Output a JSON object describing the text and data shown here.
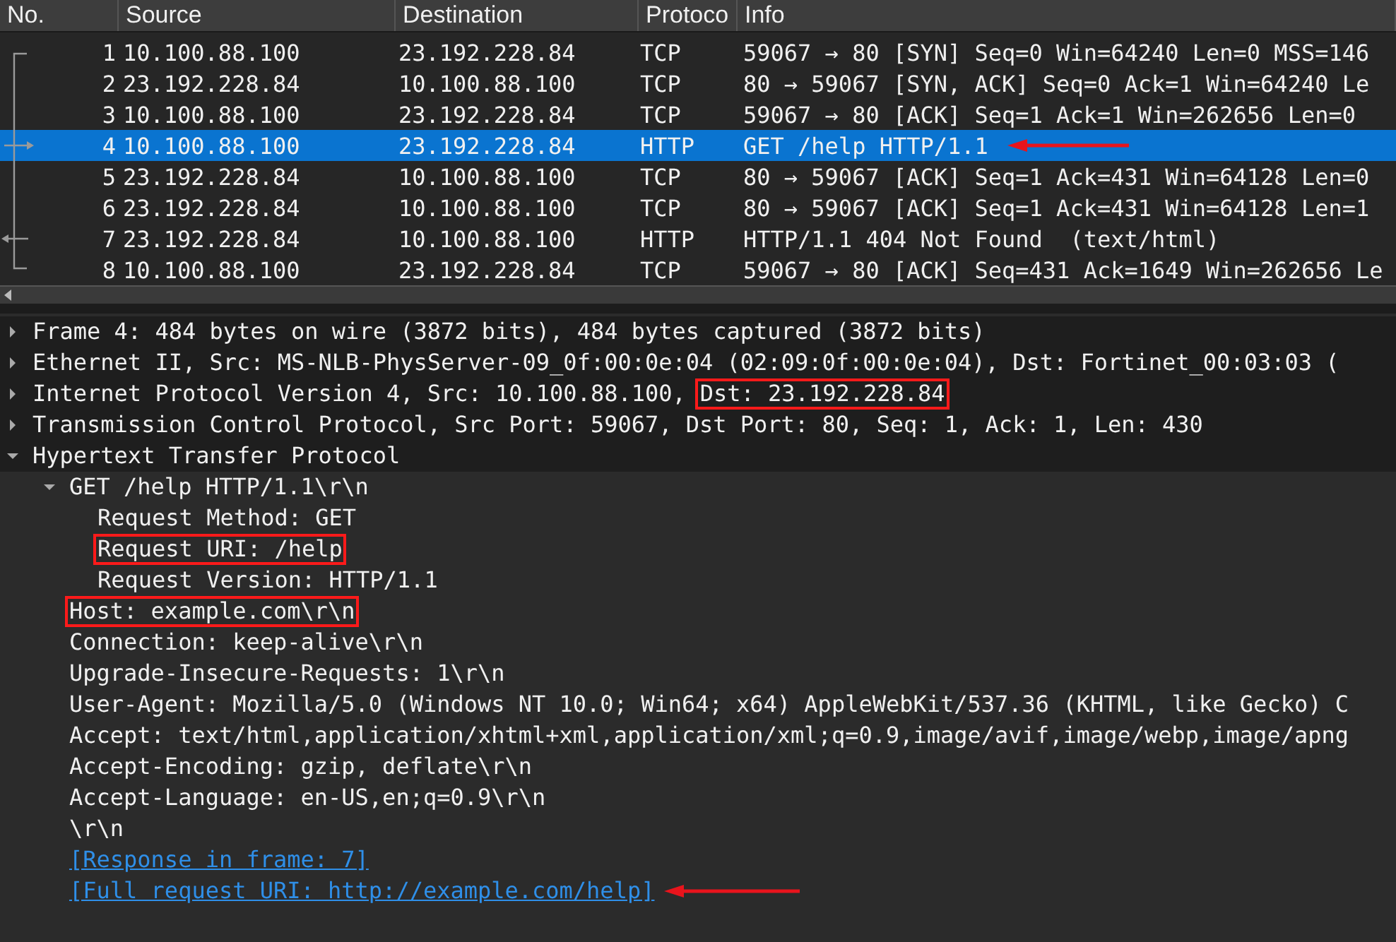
{
  "packet_list": {
    "columns": [
      "No.",
      "Source",
      "Destination",
      "Protoco",
      "Info"
    ],
    "rows": [
      {
        "no": "1",
        "source": "10.100.88.100",
        "destination": "23.192.228.84",
        "protocol": "TCP",
        "info": "59067 → 80 [SYN] Seq=0 Win=64240 Len=0 MSS=146",
        "selected": false,
        "kind": "first",
        "arrow": false
      },
      {
        "no": "2",
        "source": "23.192.228.84",
        "destination": "10.100.88.100",
        "protocol": "TCP",
        "info": "80 → 59067 [SYN, ACK] Seq=0 Ack=1 Win=64240 Le",
        "selected": false,
        "kind": "line",
        "arrow": false
      },
      {
        "no": "3",
        "source": "10.100.88.100",
        "destination": "23.192.228.84",
        "protocol": "TCP",
        "info": "59067 → 80 [ACK] Seq=1 Ack=1 Win=262656 Len=0",
        "selected": false,
        "kind": "line",
        "arrow": false
      },
      {
        "no": "4",
        "source": "10.100.88.100",
        "destination": "23.192.228.84",
        "protocol": "HTTP",
        "info": "GET /help HTTP/1.1",
        "selected": true,
        "kind": "request",
        "arrow": true
      },
      {
        "no": "5",
        "source": "23.192.228.84",
        "destination": "10.100.88.100",
        "protocol": "TCP",
        "info": "80 → 59067 [ACK] Seq=1 Ack=431 Win=64128 Len=0",
        "selected": false,
        "kind": "line",
        "arrow": false
      },
      {
        "no": "6",
        "source": "23.192.228.84",
        "destination": "10.100.88.100",
        "protocol": "TCP",
        "info": "80 → 59067 [ACK] Seq=1 Ack=431 Win=64128 Len=1",
        "selected": false,
        "kind": "line",
        "arrow": false
      },
      {
        "no": "7",
        "source": "23.192.228.84",
        "destination": "10.100.88.100",
        "protocol": "HTTP",
        "info": "HTTP/1.1 404 Not Found  (text/html)",
        "selected": false,
        "kind": "response",
        "arrow": false
      },
      {
        "no": "8",
        "source": "10.100.88.100",
        "destination": "23.192.228.84",
        "protocol": "TCP",
        "info": "59067 → 80 [ACK] Seq=431 Ack=1649 Win=262656 Le",
        "selected": false,
        "kind": "last",
        "arrow": false
      }
    ]
  },
  "details": [
    {
      "label": "Frame 4: 484 bytes on wire (3872 bits), 484 bytes captured (3872 bits)",
      "expanded": false,
      "highlighted": false
    },
    {
      "label": "Ethernet II, Src: MS-NLB-PhysServer-09_0f:00:0e:04 (02:09:0f:00:0e:04), Dst: Fortinet_00:03:03 (",
      "expanded": false,
      "highlighted": false
    },
    {
      "label": "Internet Protocol Version 4, Src: 10.100.88.100,",
      "expanded": false,
      "highlighted": false,
      "tag": {
        "text": "Dst: 23.192.228.84",
        "highlighted": true
      }
    },
    {
      "label": "Transmission Control Protocol, Src Port: 59067, Dst Port: 80, Seq: 1, Ack: 1, Len: 430",
      "expanded": false,
      "highlighted": false
    },
    {
      "label": "Hypertext Transfer Protocol",
      "expanded": true,
      "highlighted": false,
      "children": [
        {
          "label": "GET /help HTTP/1.1\\r\\n",
          "kind": "field",
          "expanded": true,
          "highlighted": false,
          "arrow": false,
          "children": [
            {
              "label": "Request Method: GET",
              "kind": "field",
              "highlighted": false,
              "arrow": false
            },
            {
              "label": "Request URI: /help",
              "kind": "field",
              "highlighted": true,
              "arrow": false
            },
            {
              "label": "Request Version: HTTP/1.1",
              "kind": "field",
              "highlighted": false,
              "arrow": false
            }
          ]
        },
        {
          "label": "Host: example.com\\r\\n",
          "kind": "field",
          "highlighted": true,
          "arrow": false
        },
        {
          "label": "Connection: keep-alive\\r\\n",
          "kind": "field",
          "highlighted": false,
          "arrow": false
        },
        {
          "label": "Upgrade-Insecure-Requests: 1\\r\\n",
          "kind": "field",
          "highlighted": false,
          "arrow": false
        },
        {
          "label": "User-Agent: Mozilla/5.0 (Windows NT 10.0; Win64; x64) AppleWebKit/537.36 (KHTML, like Gecko) C",
          "kind": "field",
          "highlighted": false,
          "arrow": false
        },
        {
          "label": "Accept: text/html,application/xhtml+xml,application/xml;q=0.9,image/avif,image/webp,image/apng",
          "kind": "field",
          "highlighted": false,
          "arrow": false
        },
        {
          "label": "Accept-Encoding: gzip, deflate\\r\\n",
          "kind": "field",
          "highlighted": false,
          "arrow": false
        },
        {
          "label": "Accept-Language: en-US,en;q=0.9\\r\\n",
          "kind": "field",
          "highlighted": false,
          "arrow": false
        },
        {
          "label": "\\r\\n",
          "kind": "field",
          "highlighted": false,
          "arrow": false
        },
        {
          "label": "[Response in frame: 7]",
          "kind": "link",
          "highlighted": false,
          "arrow": false
        },
        {
          "label": "[Full request URI: http://example.com/help]",
          "kind": "link",
          "highlighted": false,
          "arrow": true
        }
      ]
    }
  ]
}
